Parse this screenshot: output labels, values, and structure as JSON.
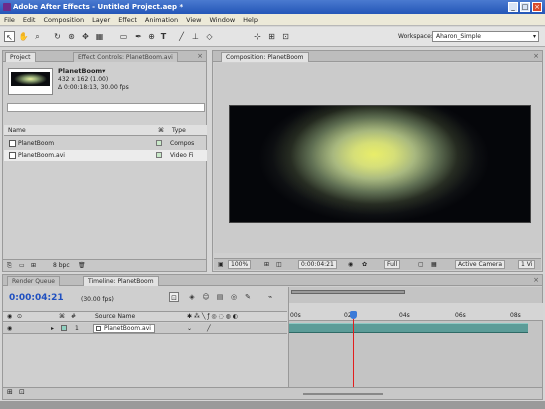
{
  "window": {
    "title": "Adobe After Effects - Untitled Project.aep *",
    "controls": [
      "_",
      "□",
      "×"
    ]
  },
  "menu": [
    "File",
    "Edit",
    "Composition",
    "Layer",
    "Effect",
    "Animation",
    "View",
    "Window",
    "Help"
  ],
  "toolbar": {
    "workspace_label": "Workspace:",
    "workspace_value": "Aharon_Simple"
  },
  "project_panel": {
    "tab_project": "Project",
    "tab_effect_controls": "Effect Controls: PlanetBoom.avi",
    "item_name": "PlanetBoom▾",
    "item_size": "432 x 162 (1.00)",
    "item_duration": "Δ 0:00:18:13, 30.00 fps",
    "col_name": "Name",
    "col_type": "Type",
    "rows": [
      {
        "name": "PlanetBoom",
        "type": "Compos"
      },
      {
        "name": "PlanetBoom.avi",
        "type": "Video Fi"
      }
    ],
    "footer_bpc": "8 bpc"
  },
  "comp_panel": {
    "tab": "Composition: PlanetBoom",
    "zoom": "100%",
    "timecode": "0:00:04:21",
    "resolution": "Full",
    "camera": "Active Camera",
    "views": "1 Vi"
  },
  "timeline": {
    "tab_render": "Render Queue",
    "tab_timeline": "Timeline: PlanetBoom",
    "timecode": "0:00:04:21",
    "fps": "(30.00 fps)",
    "col_num": "#",
    "col_source": "Source Name",
    "layer_num": "1",
    "layer_name": "PlanetBoom.avi",
    "ruler_ticks": [
      "00s",
      "02s",
      "04s",
      "06s",
      "08s"
    ],
    "playhead_fraction": 0.26
  },
  "colors": {
    "title_bar": "#2456b7",
    "timecode": "#2050c0",
    "layer_bar": "#5c9c98",
    "playhead_line": "#e21d1d"
  }
}
